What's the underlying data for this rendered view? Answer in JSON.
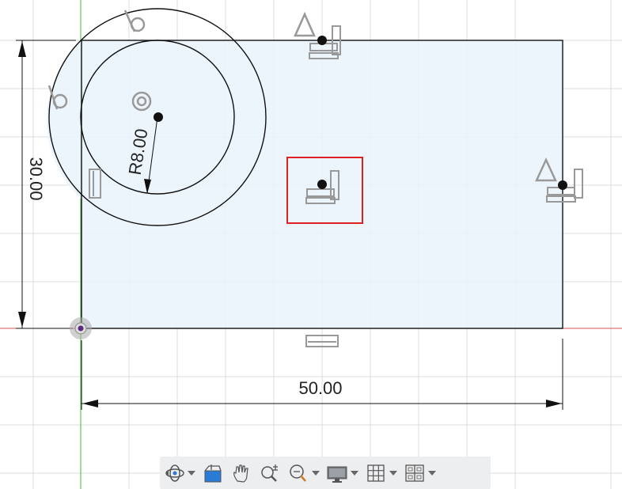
{
  "sketch": {
    "width_dimension": "50.00",
    "height_dimension": "30.00",
    "radius_dimension": "R8.00"
  },
  "colors": {
    "profile_fill": "#eaf3fc",
    "grid": "#d9dcdf",
    "x_axis": "#e05050",
    "y_axis": "#39c239",
    "selection_box": "#e02020",
    "origin_point": "#5a2a80"
  },
  "toolbar": {
    "items": [
      {
        "icon": "orbit-icon",
        "has_dropdown": true
      },
      {
        "icon": "look-at-icon",
        "has_dropdown": false
      },
      {
        "icon": "pan-icon",
        "has_dropdown": false
      },
      {
        "icon": "zoom-icon",
        "has_dropdown": false
      },
      {
        "icon": "fit-icon",
        "has_dropdown": true
      },
      {
        "icon": "display-settings-icon",
        "has_dropdown": true
      },
      {
        "icon": "grid-settings-icon",
        "has_dropdown": true
      },
      {
        "icon": "viewports-icon",
        "has_dropdown": true
      }
    ]
  }
}
